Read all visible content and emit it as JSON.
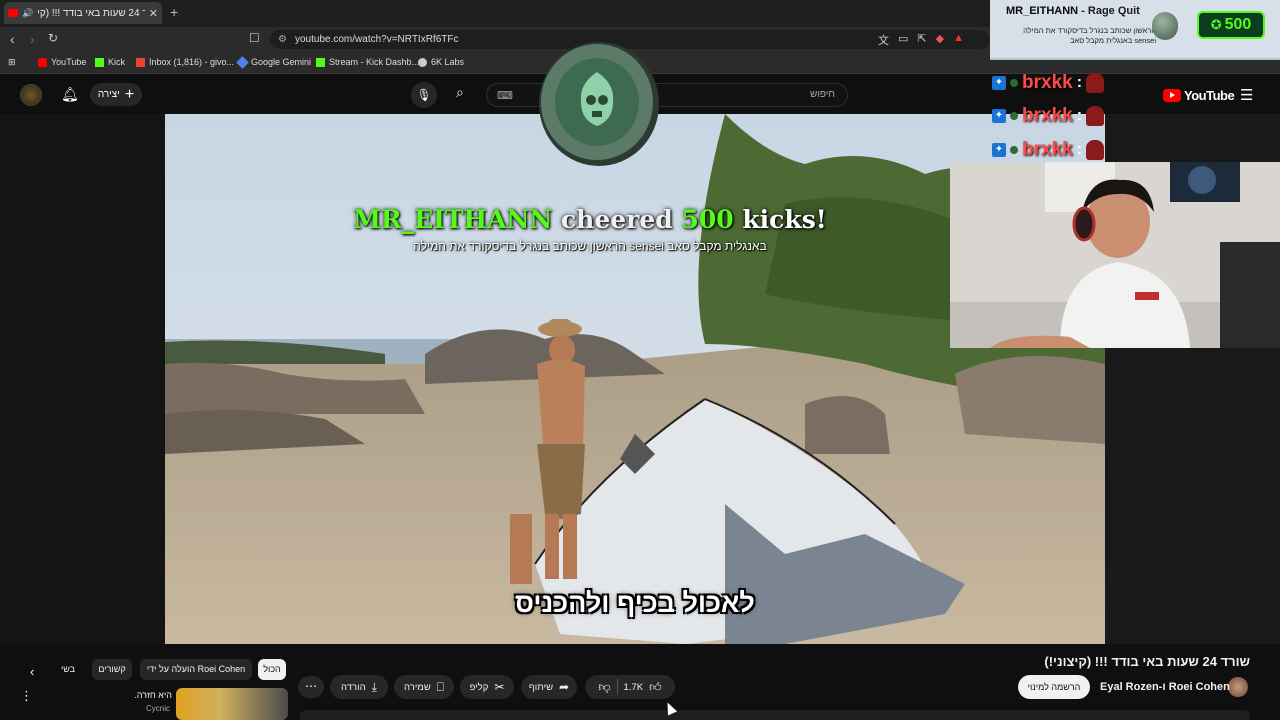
{
  "browser": {
    "tab_title": "שורד 24 שעות באי בודד !!! (קי",
    "tab_close": "✕",
    "new_tab": "+",
    "url": "youtube.com/watch?v=NRTIxRf6TFc",
    "bookmarks": [
      {
        "label": "YouTube",
        "color": "#ff0000"
      },
      {
        "label": "Kick",
        "color": "#53fc18"
      },
      {
        "label": "Inbox (1,816) - givo...",
        "color": "#ea4335"
      },
      {
        "label": "Google Gemini",
        "color": "#4e82ee"
      },
      {
        "label": "Stream - Kick Dashb...",
        "color": "#53fc18"
      },
      {
        "label": "6K Labs",
        "color": "#cccccc"
      }
    ]
  },
  "youtube_header": {
    "search_placeholder": "חיפוש",
    "create_label": "יצירה",
    "logo_text": "YouTube"
  },
  "alert": {
    "name": "MR_EITHANN",
    "verb": "cheered",
    "amount": "500",
    "unit": "kicks!",
    "message": "באנגלית מקבל סאב sensei הראשון שכותב בנגרל בדיסקורד את המילה"
  },
  "goal_widget": {
    "title_name": "MR_EITHANN",
    "title_suffix": " - Rage Quit",
    "message": "הראשון שכותב בנגרל בדיסקורד את המילה sensei באנגלית מקבל סאב",
    "amount": "500"
  },
  "chat": [
    {
      "user": "brxkk",
      "colon": ":"
    },
    {
      "user": "brxkk",
      "colon": ":"
    },
    {
      "user": "brxkk",
      "colon": ":"
    }
  ],
  "video": {
    "subtitle": "לאכול בכיף ולהכניס",
    "title": "שורד 24 שעות באי בודד !!! (קיצוני!)",
    "channel": "Eyal Rozen-ו Roei Cohen",
    "subscribe_label": "הרשמה למינוי",
    "likes": "1.7K",
    "share_label": "שיתוף",
    "clip_label": "קליפ",
    "save_label": "שמירה",
    "download_label": "הורדה",
    "more_label": "⋯"
  },
  "chips": {
    "all": "הכול",
    "uploaded_by": "הועלה על ידי Roei Cohen",
    "related": "קשורים",
    "recent": "בשי"
  },
  "recommendation": {
    "title": "היא חזרה.",
    "channel": "Cycnic"
  },
  "colors": {
    "kick_green": "#53fc18",
    "chat_user": "#ff4a4a",
    "yt_red": "#ff0000"
  }
}
